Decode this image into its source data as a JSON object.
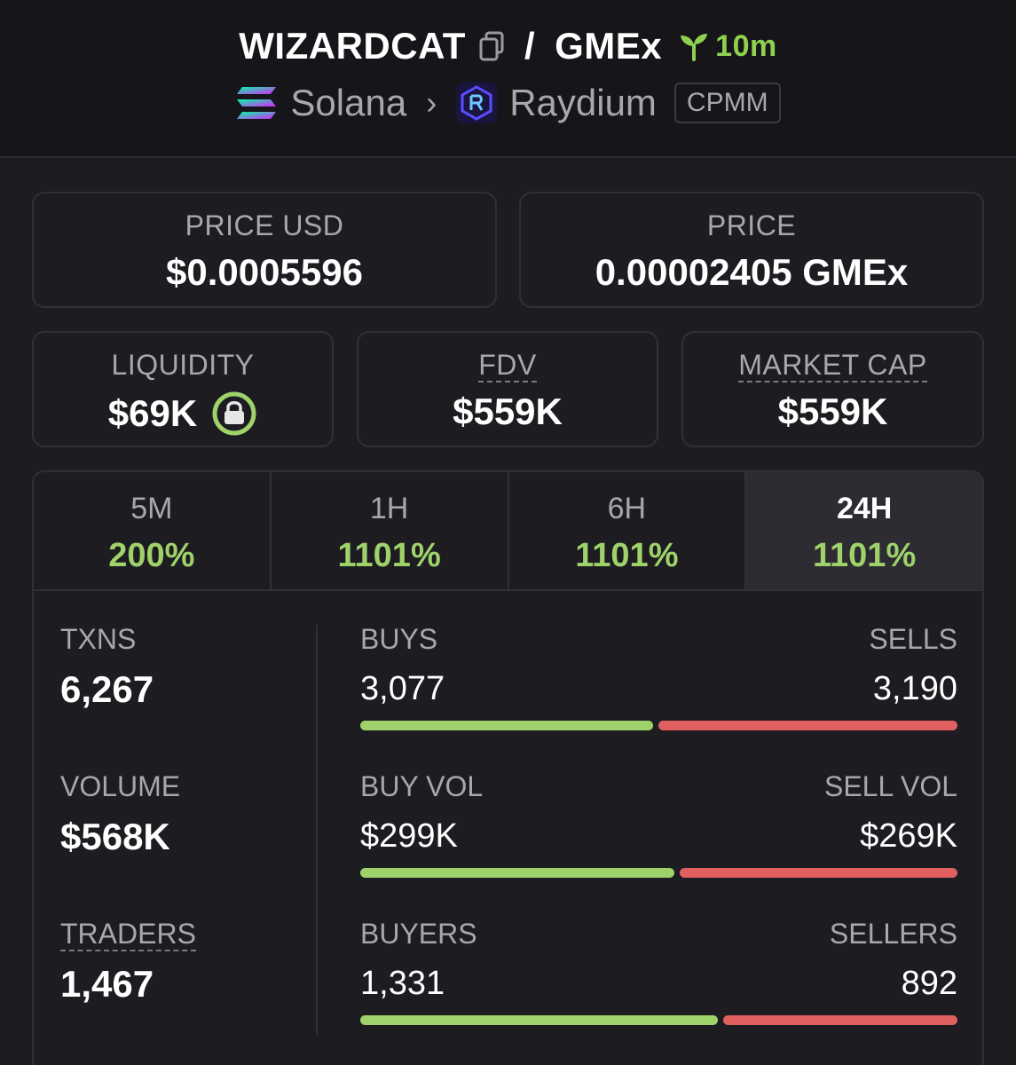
{
  "header": {
    "token": "WIZARDCAT",
    "separator": "/",
    "quote": "GMEx",
    "age": "10m",
    "chain": "Solana",
    "dex": "Raydium",
    "pool_type": "CPMM"
  },
  "prices": {
    "price_usd_label": "PRICE USD",
    "price_usd": "$0.0005596",
    "price_label": "PRICE",
    "price": "0.00002405 GMEx"
  },
  "metrics": {
    "liquidity_label": "LIQUIDITY",
    "liquidity": "$69K",
    "fdv_label": "FDV",
    "fdv": "$559K",
    "mcap_label": "MARKET CAP",
    "mcap": "$559K"
  },
  "tabs": [
    {
      "label": "5M",
      "value": "200%"
    },
    {
      "label": "1H",
      "value": "1101%"
    },
    {
      "label": "6H",
      "value": "1101%"
    },
    {
      "label": "24H",
      "value": "1101%"
    }
  ],
  "stats": {
    "txns_label": "TXNS",
    "txns": "6,267",
    "volume_label": "VOLUME",
    "volume": "$568K",
    "traders_label": "TRADERS",
    "traders": "1,467"
  },
  "splits": [
    {
      "left_label": "BUYS",
      "right_label": "SELLS",
      "left_value": "3,077",
      "right_value": "3,190",
      "buy_fraction": 0.491
    },
    {
      "left_label": "BUY VOL",
      "right_label": "SELL VOL",
      "left_value": "$299K",
      "right_value": "$269K",
      "buy_fraction": 0.526
    },
    {
      "left_label": "BUYERS",
      "right_label": "SELLERS",
      "left_value": "1,331",
      "right_value": "892",
      "buy_fraction": 0.599
    }
  ],
  "colors": {
    "buy": "#9fd26a",
    "sell": "#e0605f",
    "age": "#8fd14f",
    "lock_ring": "#9fd26a"
  }
}
